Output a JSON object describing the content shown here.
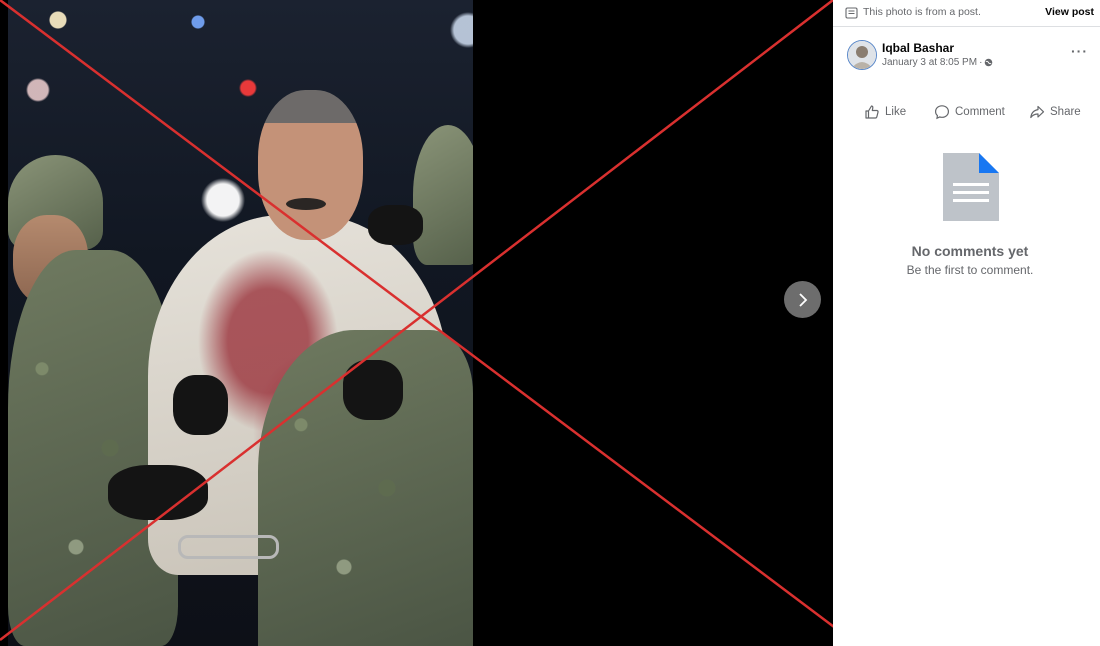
{
  "banner": {
    "text": "This photo is from a post.",
    "view_post_label": "View post"
  },
  "post": {
    "author": "Iqbal Bashar",
    "timestamp": "January 3 at 8:05 PM",
    "separator": "·",
    "privacy_icon": "globe-icon"
  },
  "actions": {
    "like_label": "Like",
    "comment_label": "Comment",
    "share_label": "Share"
  },
  "comments": {
    "empty_title": "No comments yet",
    "empty_subtitle": "Be the first to comment."
  },
  "viewer": {
    "overlay": "red-cross-mark",
    "next_icon": "chevron-right-icon"
  },
  "colors": {
    "cross_line": "#d9302f",
    "accent_blue": "#1877f2",
    "muted_text": "#65676b",
    "viewer_bg": "#000000"
  }
}
